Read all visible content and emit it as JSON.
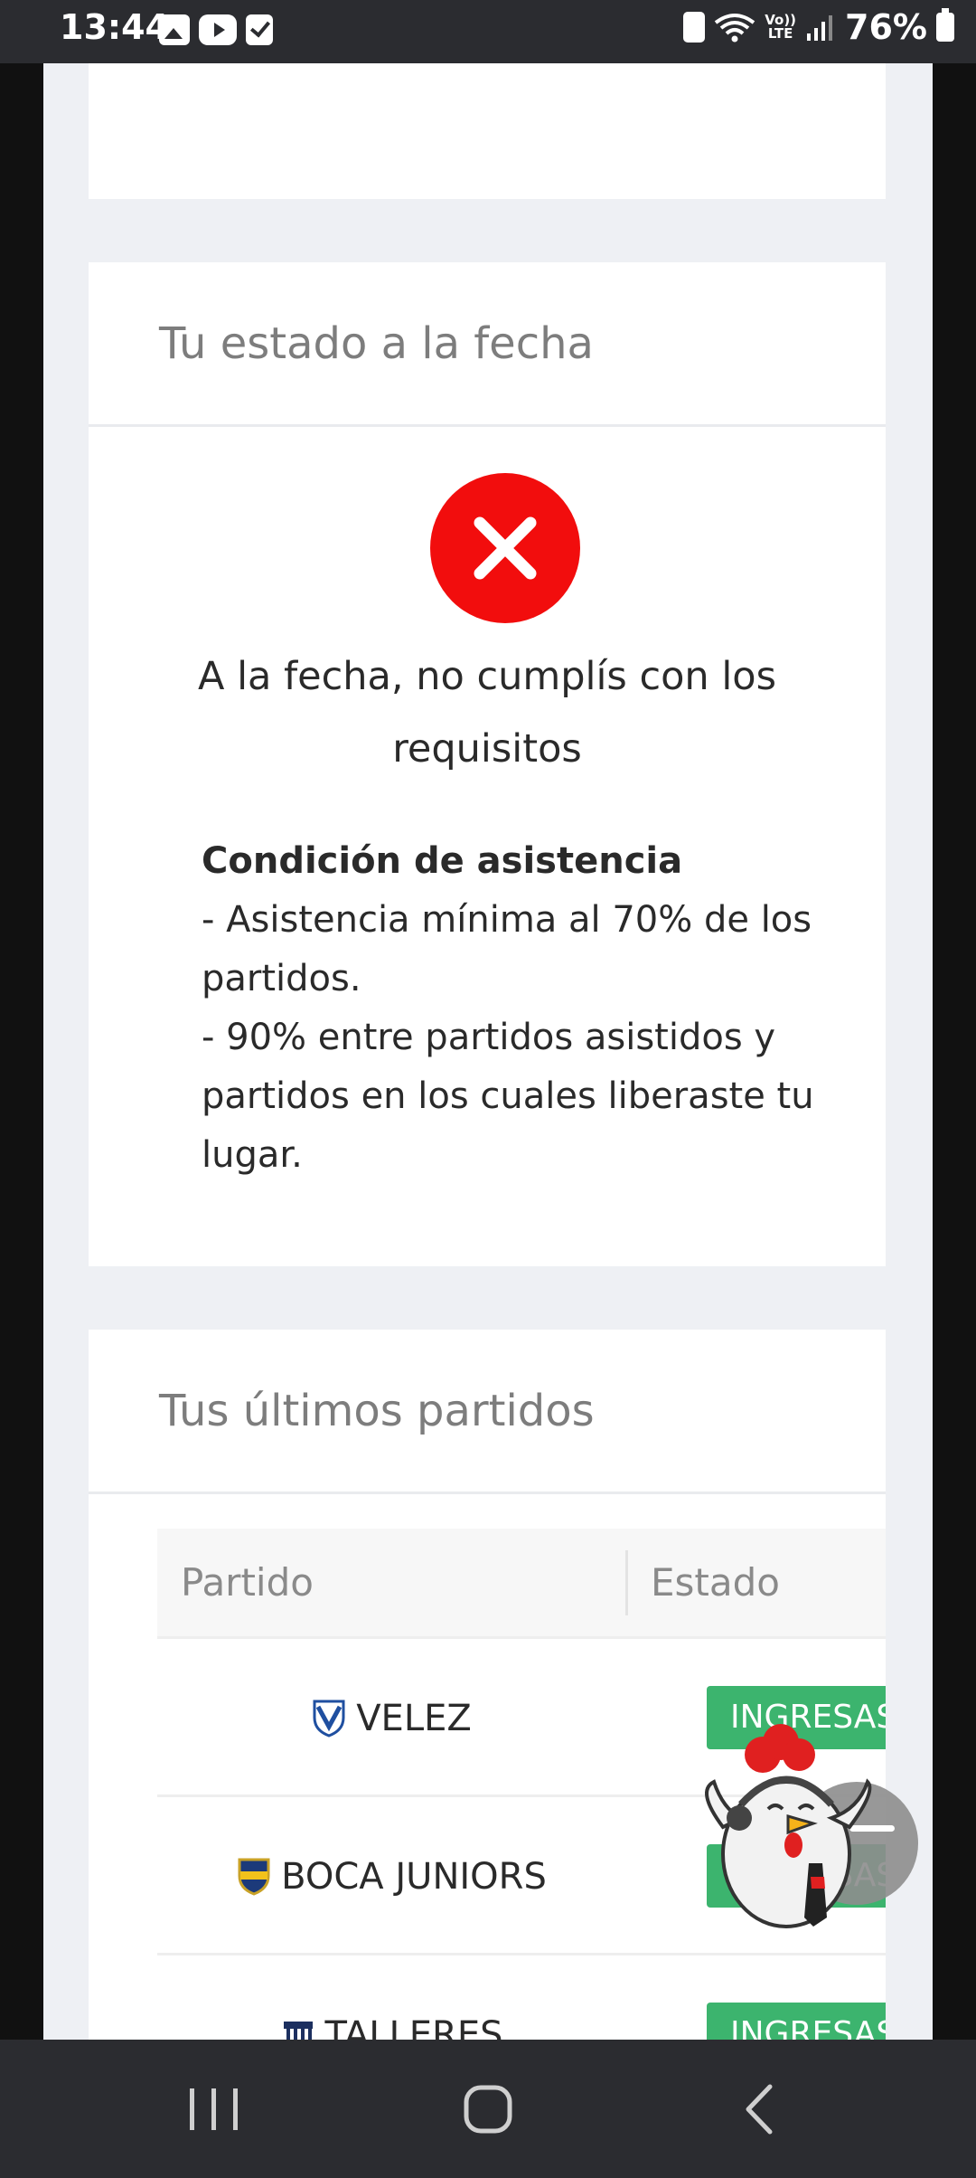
{
  "status_bar": {
    "time": "13:44",
    "left_icons": [
      "gallery-icon",
      "youtube-icon",
      "checkbox-icon"
    ],
    "lte_top": "Vo))",
    "lte_bottom": "LTE",
    "battery_percent": "76%"
  },
  "status_card": {
    "title": "Tu estado a la fecha",
    "result_icon": "error-x-icon",
    "result_color": "#f20d0d",
    "message": "A la fecha, no cumplís con los requisitos",
    "condition_title": "Condición de asistencia",
    "condition_line1": "- Asistencia mínima al 70% de los partidos.",
    "condition_line2": "- 90% entre partidos asistidos y partidos en los cuales liberaste tu lugar."
  },
  "matches_card": {
    "title": "Tus últimos partidos",
    "columns": {
      "partido": "Partido",
      "estado": "Estado"
    },
    "rows": [
      {
        "team": "VELEZ",
        "estado": "INGRESASTE",
        "crest": "velez-crest-icon"
      },
      {
        "team": "BOCA JUNIORS",
        "estado": "INGRESASTE",
        "crest": "boca-crest-icon"
      },
      {
        "team": "TALLERES",
        "estado": "INGRESASTE",
        "crest": "talleres-crest-icon"
      }
    ],
    "badge_color": "#3cb46e"
  },
  "nav_bar": {
    "buttons": [
      "recent-apps-icon",
      "home-icon",
      "back-icon"
    ]
  }
}
